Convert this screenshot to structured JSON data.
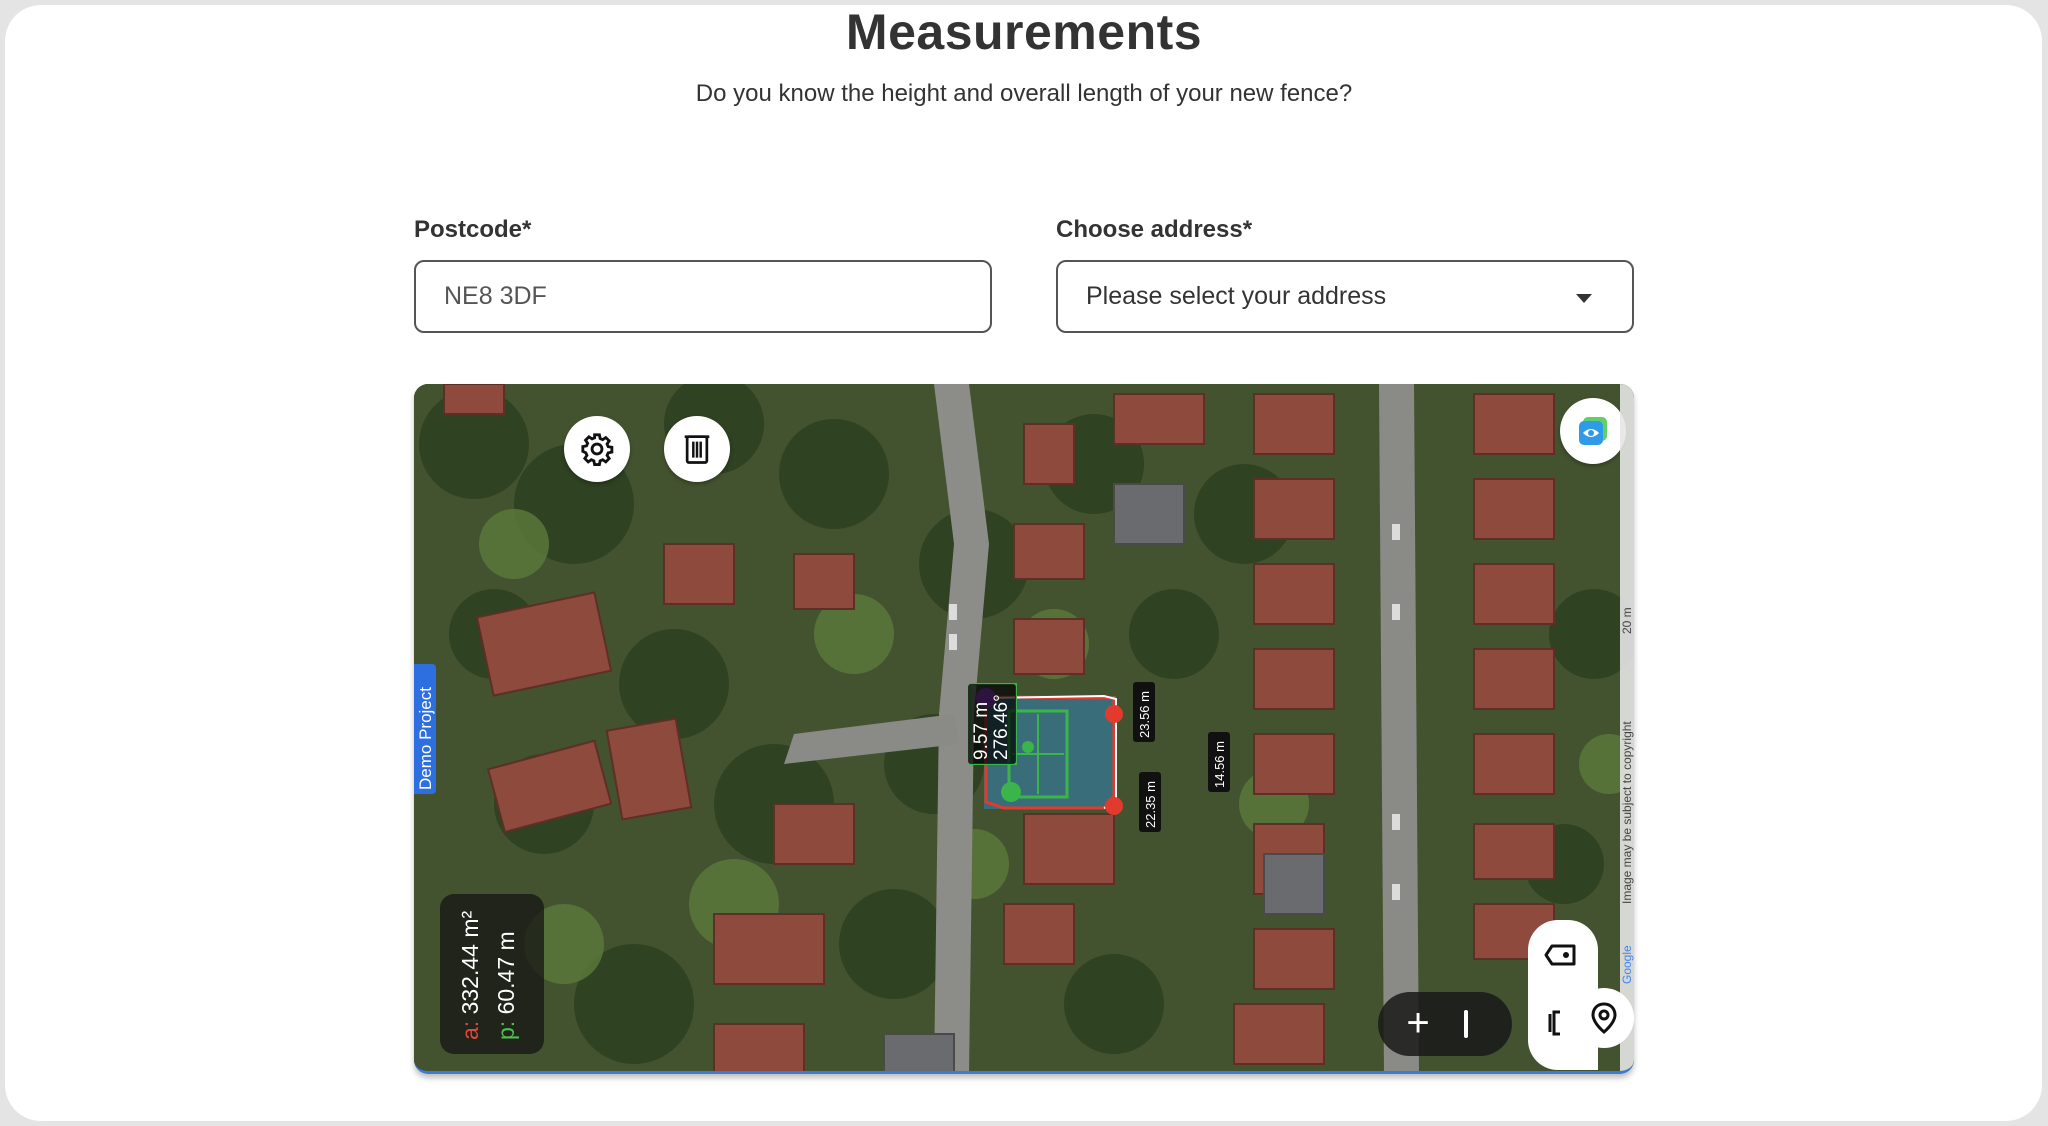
{
  "page": {
    "title": "Measurements",
    "subtitle": "Do you know the height and overall length of your new fence?"
  },
  "form": {
    "postcode_label": "Postcode*",
    "postcode_value": "NE8 3DF",
    "address_label": "Choose address*",
    "address_placeholder": "Please select your address"
  },
  "map": {
    "demo_tab": "Demo Project",
    "area_key": "a:",
    "area_value": "332.44 m²",
    "perimeter_key": "p:",
    "perimeter_value": "60.47 m",
    "angle_label": "276.46°",
    "dimensions": [
      "9.57 m",
      "23.56 m",
      "14.56 m",
      "22.35 m"
    ],
    "scale_text": "20 m",
    "copyright_text": "Image may be subject to copyright",
    "google_text": "Google"
  },
  "icons": [
    "gear-icon",
    "trash-icon",
    "layers-icon",
    "ruler-tag-icon",
    "bracket-icon",
    "location-pin-icon",
    "plus-icon",
    "minus-icon"
  ]
}
